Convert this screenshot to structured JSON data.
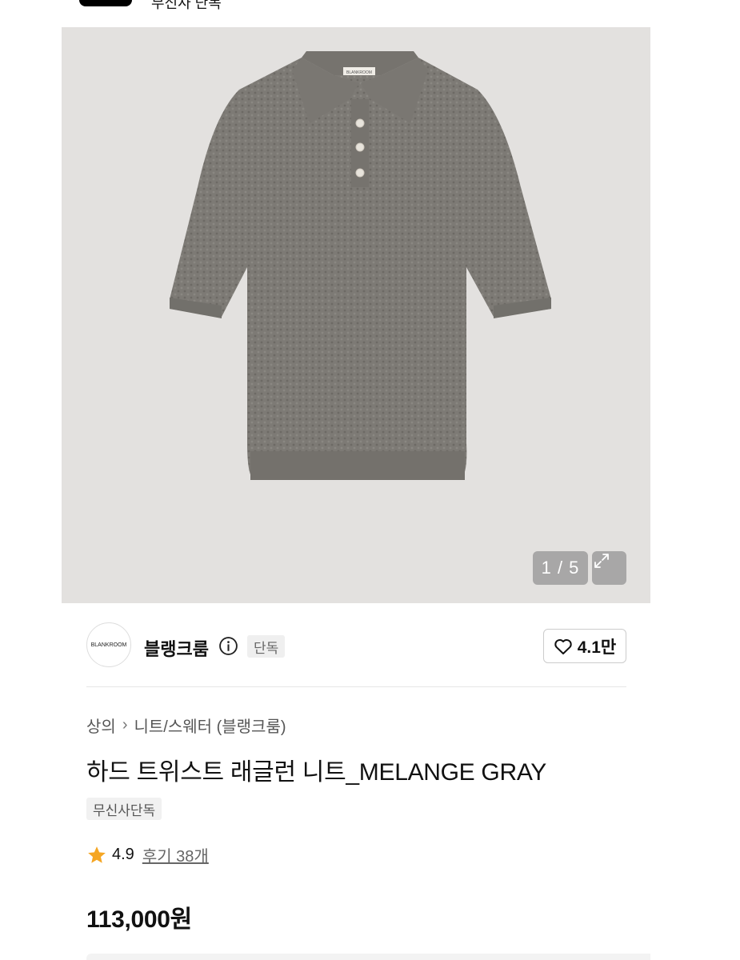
{
  "topbar": {
    "label": "무신사 단독"
  },
  "gallery": {
    "counter": "1 / 5",
    "background": "#e3e1df",
    "garment_color": "#7d7a75",
    "tag_text": "BLANKROOM"
  },
  "brand": {
    "logo_text": "BLANKROOM",
    "name": "블랭크룸",
    "exclusive_tag": "단독",
    "like_count": "4.1만"
  },
  "breadcrumb": {
    "category": "상의",
    "subcategory": "니트/스웨터 (블랭크룸)"
  },
  "product": {
    "title": "하드 트위스트 래글런 니트_MELANGE GRAY",
    "badge": "무신사단독",
    "rating": "4.9",
    "reviews": "후기 38개",
    "price": "113,000원"
  },
  "colors": {
    "star": "#f5a623",
    "text": "#111111"
  }
}
